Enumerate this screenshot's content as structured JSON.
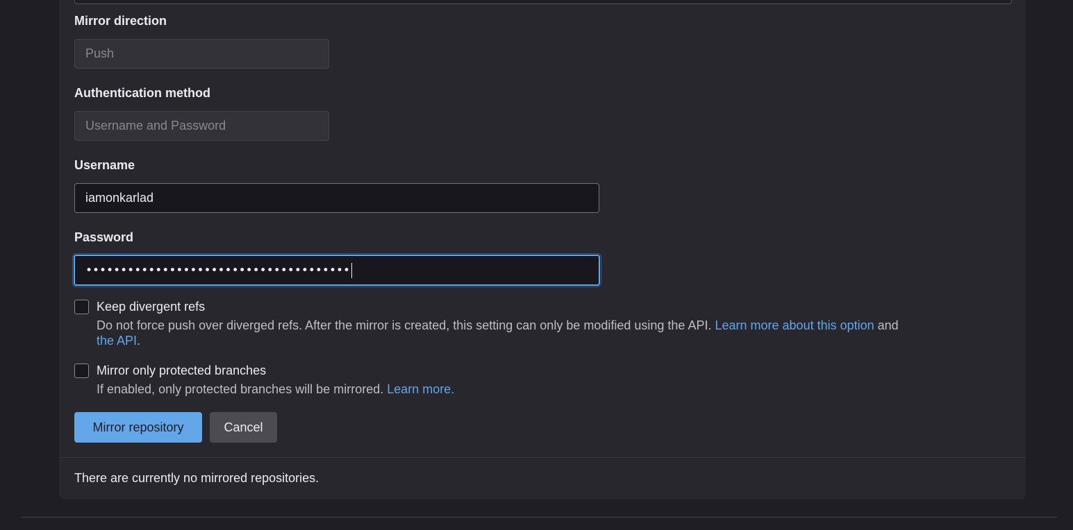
{
  "form": {
    "mirror_direction": {
      "label": "Mirror direction",
      "value": "Push"
    },
    "auth_method": {
      "label": "Authentication method",
      "value": "Username and Password"
    },
    "username": {
      "label": "Username",
      "value": "iamonkarlad"
    },
    "password": {
      "label": "Password",
      "masked_value": "••••••••••••••••••••••••••••••••••••••"
    },
    "keep_divergent_refs": {
      "label": "Keep divergent refs",
      "checked": false,
      "help_text": "Do not force push over diverged refs. After the mirror is created, this setting can only be modified using the API.",
      "link_1": "Learn more about this option",
      "and_text": "and",
      "link_2": "the API",
      "trailing": "."
    },
    "protected_branches": {
      "label": "Mirror only protected branches",
      "checked": false,
      "help_text": "If enabled, only protected branches will be mirrored.",
      "link": "Learn more."
    },
    "buttons": {
      "submit": "Mirror repository",
      "cancel": "Cancel"
    }
  },
  "mirrors": {
    "empty_text": "There are currently no mirrored repositories."
  },
  "colors": {
    "background": "#1f1e24",
    "card": "#28272d",
    "accent": "#63a6e9",
    "link": "#63a6e9"
  }
}
